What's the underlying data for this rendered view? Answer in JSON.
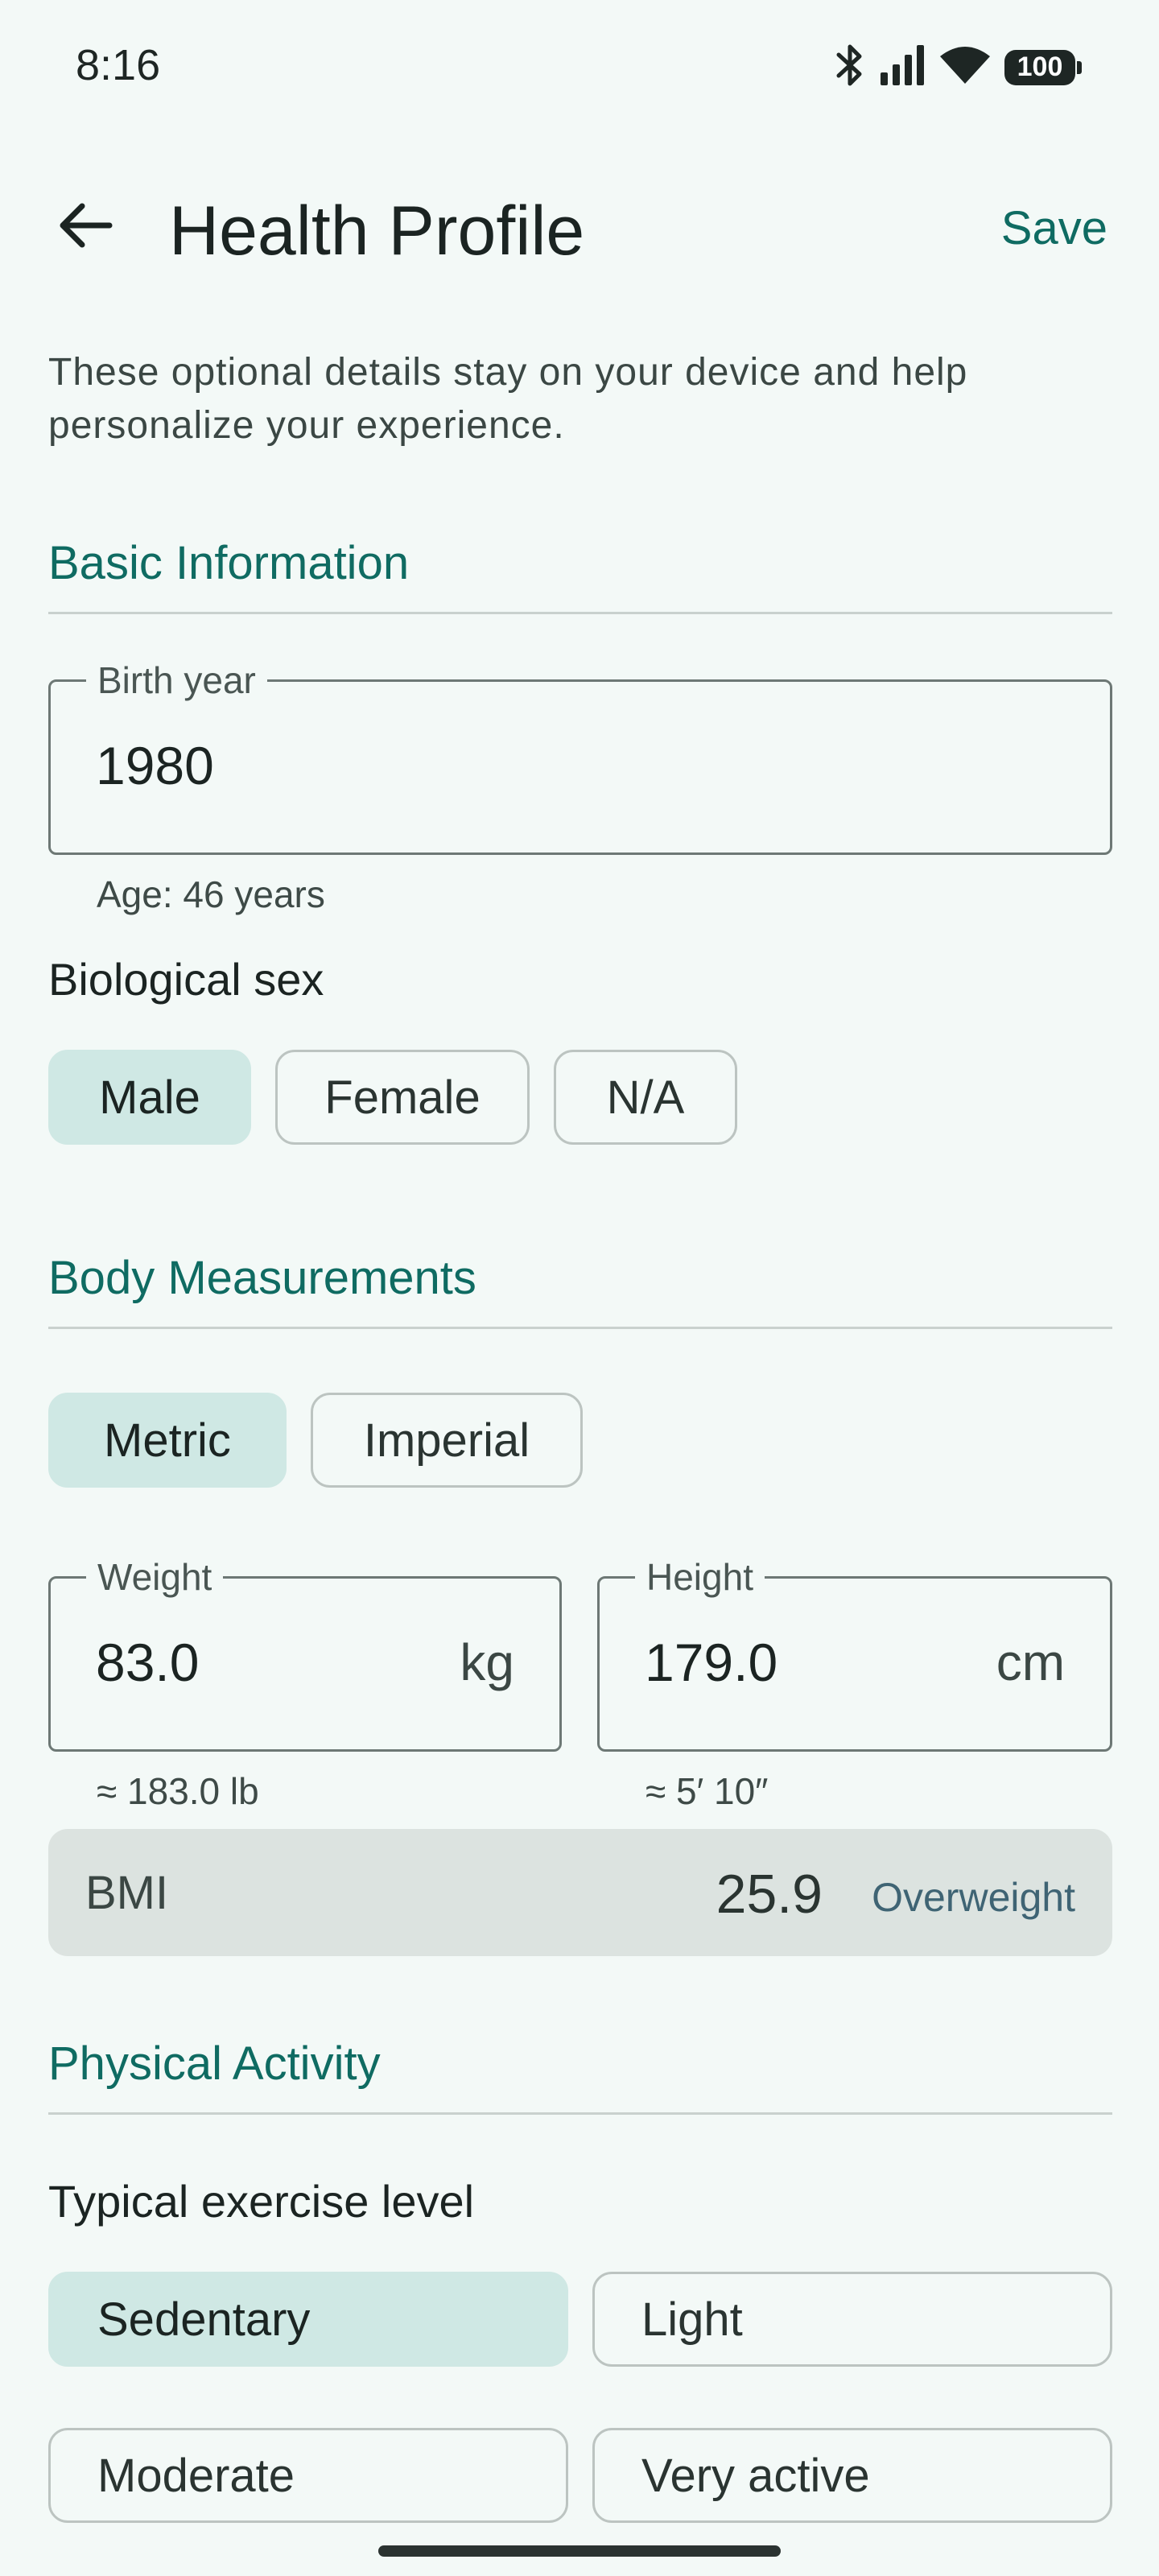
{
  "status_bar": {
    "time": "8:16",
    "battery": "100",
    "icons": [
      "bluetooth-icon",
      "signal-icon",
      "wifi-icon",
      "battery-icon"
    ]
  },
  "app_bar": {
    "title": "Health Profile",
    "save_label": "Save",
    "back_icon": "back-arrow-icon"
  },
  "intro_text": "These optional details stay on your device and help personalize your experience.",
  "basic": {
    "section_title": "Basic Information",
    "birth_year_label": "Birth year",
    "birth_year_value": "1980",
    "age_helper": "Age: 46 years",
    "sex_label": "Biological sex",
    "sex_options": [
      "Male",
      "Female",
      "N/A"
    ],
    "sex_selected": "Male"
  },
  "body": {
    "section_title": "Body Measurements",
    "unit_options": [
      "Metric",
      "Imperial"
    ],
    "unit_selected": "Metric",
    "weight_label": "Weight",
    "weight_value": "83.0",
    "weight_unit": "kg",
    "weight_helper": "≈ 183.0 lb",
    "height_label": "Height",
    "height_value": "179.0",
    "height_unit": "cm",
    "height_helper": "≈ 5′ 10″",
    "bmi_label": "BMI",
    "bmi_value": "25.9",
    "bmi_category": "Overweight"
  },
  "activity": {
    "section_title": "Physical Activity",
    "exercise_label": "Typical exercise level",
    "options": [
      "Sedentary",
      "Light",
      "Moderate",
      "Very active"
    ],
    "selected": "Sedentary"
  },
  "colors": {
    "accent": "#0f6b62",
    "background": "#f3f9f7",
    "selected_chip": "#cfe8e4",
    "bmi_card": "#dce3e0",
    "bmi_category": "#3f6474"
  }
}
